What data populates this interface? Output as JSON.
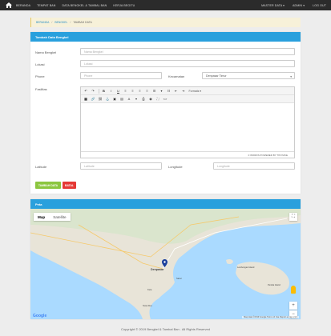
{
  "navbar": {
    "home_icon": "home-icon",
    "links": [
      "BERANDA",
      "TEMPAT BAN",
      "DATA BENGKEL & TAMBAL BAN",
      "KERJA BEGITU"
    ],
    "right": [
      "MASTER DATA ▾",
      "ADMIN ▾",
      "LOG OUT"
    ]
  },
  "breadcrumb": {
    "items": [
      "BERANDA",
      "BENGKEL",
      "TAMBAH DATA"
    ]
  },
  "form": {
    "title": "Tambah Data Bengkel",
    "nama_label": "Nama Bengkel",
    "nama_placeholder": "Nama Bengkel",
    "lokasi_label": "Lokasi",
    "lokasi_placeholder": "Lokasi",
    "phone_label": "Phone",
    "phone_placeholder": "Phone",
    "kecamatan_label": "Kecamatan",
    "kecamatan_value": "Denpasar Timur",
    "fasilitas_label": "Fasilitas",
    "editor_formats": "Formats ▾",
    "editor_status": "0 WORDS POWERED BY TINYMCE",
    "latitude_label": "Latitude",
    "latitude_placeholder": "Latitude",
    "longitude_label": "Longitude",
    "longitude_placeholder": "Longitude",
    "save_label": "TAMBAH DATA",
    "cancel_label": "BATAL"
  },
  "map": {
    "title": "Peta",
    "type_map": "Map",
    "type_satellite": "Satellite",
    "labels": [
      "Denpasar",
      "Sanur",
      "Kuta",
      "Nusa Dua",
      "Lembongan Island",
      "Penida Island"
    ],
    "attribution": "Map data ©2019 Google   Terms of Use   Report a map error",
    "google_logo": "Google"
  },
  "footer": "Copyright © 2019 Bengkel & Tambal Ban . All Rights Reserved"
}
